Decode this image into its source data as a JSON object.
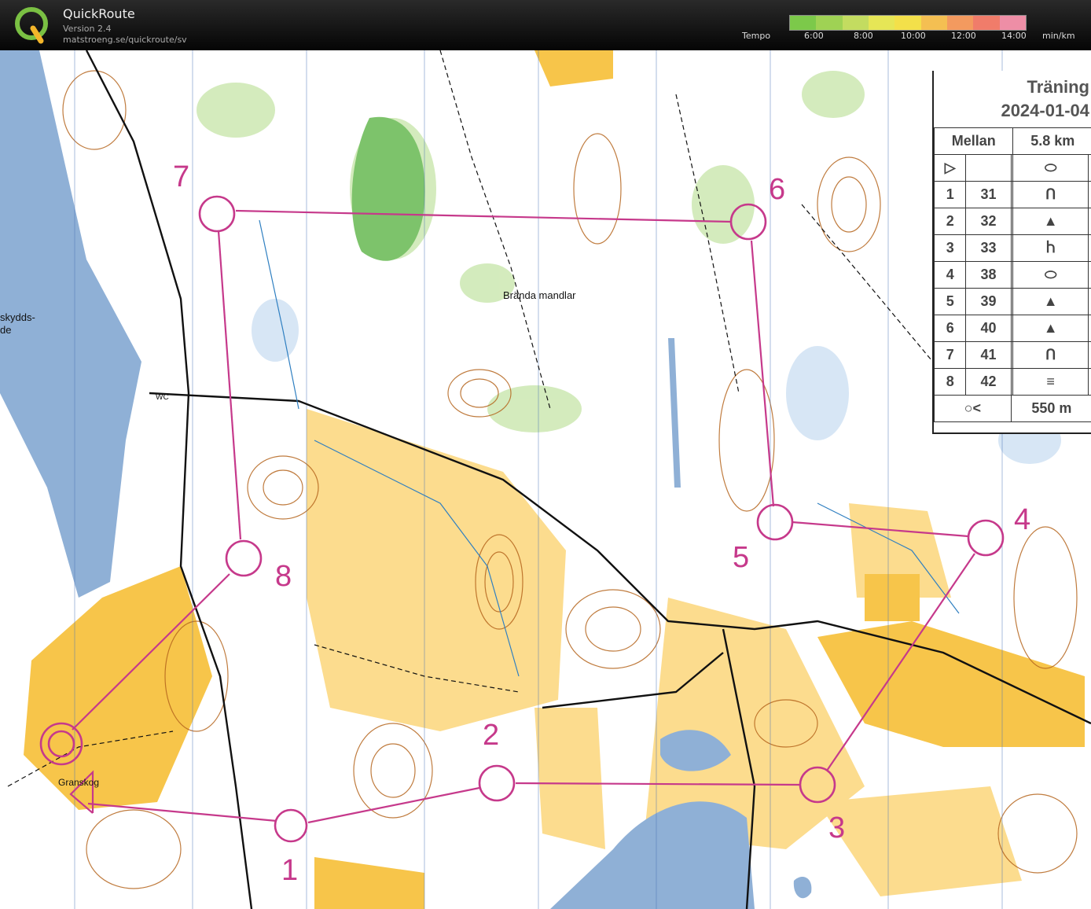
{
  "app": {
    "name": "QuickRoute",
    "version": "Version 2.4",
    "url": "matstroeng.se/quickroute/sv"
  },
  "tempo_scale": {
    "label": "Tempo",
    "ticks": [
      "6:00",
      "8:00",
      "10:00",
      "12:00",
      "14:00"
    ],
    "unit": "min/km",
    "colors": [
      "#7cc94a",
      "#f3e04a",
      "#f07c6a"
    ]
  },
  "legend": {
    "event": "Träning",
    "date": "2024-01-04",
    "course_name": "Mellan",
    "course_length": "5.8 km",
    "controls": [
      {
        "num": "1",
        "code": "31",
        "symbol": "Ո"
      },
      {
        "num": "2",
        "code": "32",
        "symbol": "▲"
      },
      {
        "num": "3",
        "code": "33",
        "symbol": "Ⴙ"
      },
      {
        "num": "4",
        "code": "38",
        "symbol": "⬭"
      },
      {
        "num": "5",
        "code": "39",
        "symbol": "▲"
      },
      {
        "num": "6",
        "code": "40",
        "symbol": "▲"
      },
      {
        "num": "7",
        "code": "41",
        "symbol": "Ո"
      },
      {
        "num": "8",
        "code": "42",
        "symbol": "≡"
      }
    ],
    "finish_distance": "550 m"
  },
  "map": {
    "place_names": [
      "Brända mandlar",
      "Granskog",
      "skydds-",
      "de",
      "WC"
    ],
    "controls": [
      {
        "label": "1"
      },
      {
        "label": "2"
      },
      {
        "label": "3"
      },
      {
        "label": "4"
      },
      {
        "label": "5"
      },
      {
        "label": "6"
      },
      {
        "label": "7"
      },
      {
        "label": "8"
      }
    ],
    "course_color": "#c6398b",
    "water_color": "#8fb0d6",
    "open_land_color": "#f7c54a"
  }
}
